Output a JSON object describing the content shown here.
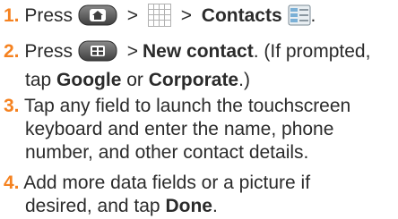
{
  "steps": [
    {
      "number": "1.",
      "press_text": "Press",
      "icons": [
        "home-key-icon",
        "applications-grid-icon",
        "contacts-app-icon"
      ],
      "separator": ">",
      "bold": "Contacts",
      "tail": "."
    },
    {
      "number": "2.",
      "press_text": "Press",
      "icons": [
        "menu-key-icon"
      ],
      "separator": ">",
      "bold": "New contact",
      "tail": ". (If prompted,",
      "line2_pre": "tap",
      "line2_bold1": "Google",
      "line2_mid": "or",
      "line2_bold2": "Corporate",
      "line2_tail": ".)"
    },
    {
      "number": "3.",
      "line1": "Tap any field to launch the touchscreen",
      "line2": "keyboard and enter the name, phone",
      "line3": "number, and other contact details."
    },
    {
      "number": "4.",
      "line1": "Add more data fields or a picture if",
      "line2_pre": "desired, and tap",
      "line2_bold": "Done",
      "line2_tail": "."
    }
  ],
  "colors": {
    "step_number": "#f58220",
    "text": "#2b2b2b",
    "key_gradient_top": "#8a8a8a",
    "key_gradient_bottom": "#3f3f3f"
  }
}
